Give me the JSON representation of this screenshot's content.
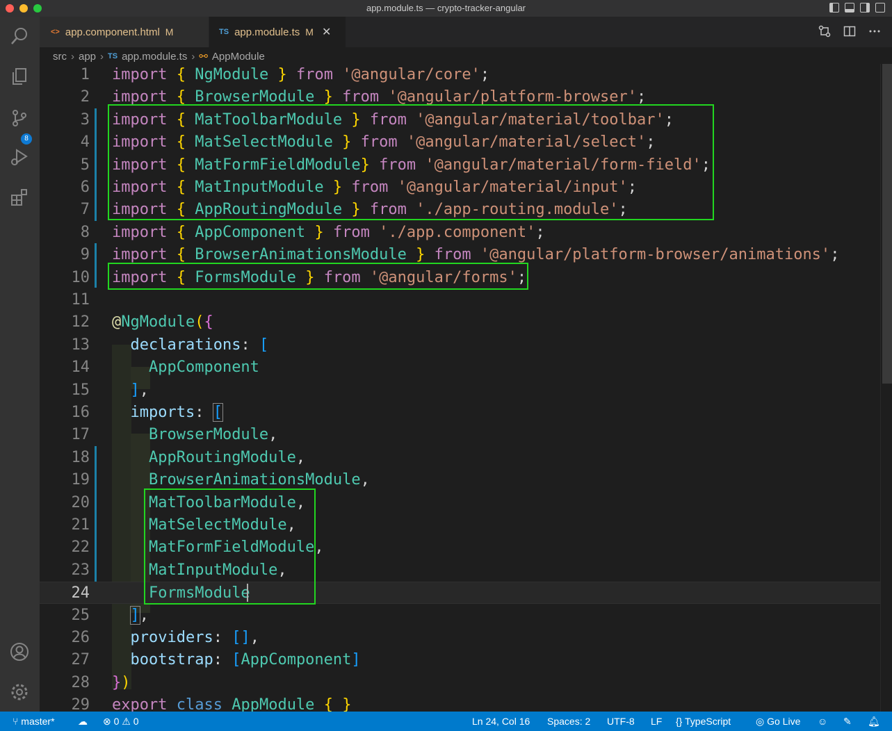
{
  "window": {
    "title": "app.module.ts — crypto-tracker-angular"
  },
  "activity_bar": {
    "scm_badge": "8"
  },
  "tabs": [
    {
      "icon": "<>",
      "label": "app.component.html",
      "status": "M"
    },
    {
      "icon": "TS",
      "label": "app.module.ts",
      "status": "M",
      "close": "✕"
    }
  ],
  "breadcrumb": {
    "parts": [
      "src",
      "app",
      "app.module.ts",
      "AppModule"
    ],
    "ts_icon": "TS",
    "sep": "›"
  },
  "code": {
    "line_numbers": [
      "1",
      "2",
      "3",
      "4",
      "5",
      "6",
      "7",
      "8",
      "9",
      "10",
      "11",
      "12",
      "13",
      "14",
      "15",
      "16",
      "17",
      "18",
      "19",
      "20",
      "21",
      "22",
      "23",
      "24",
      "25",
      "26",
      "27",
      "28",
      "29"
    ],
    "tokens": {
      "import": "import",
      "from": "from",
      "export": "export",
      "class": "class",
      "ob": "{",
      "cb": "}",
      "semi": ";",
      "ngmodule": "NgModule",
      "browsermodule": "BrowserModule",
      "toolbar": "MatToolbarModule",
      "select": "MatSelectModule",
      "formfield": "MatFormFieldModule",
      "input": "MatInputModule",
      "routing": "AppRoutingModule",
      "appcomponent": "AppComponent",
      "animations": "BrowserAnimationsModule",
      "forms": "FormsModule",
      "appmodule": "AppModule",
      "s_core": "'@angular/core'",
      "s_platform": "'@angular/platform-browser'",
      "s_toolbar": "'@angular/material/toolbar'",
      "s_select": "'@angular/material/select'",
      "s_formfield": "'@angular/material/form-field'",
      "s_input": "'@angular/material/input'",
      "s_routing": "'./app-routing.module'",
      "s_component": "'./app.component'",
      "s_animations": "'@angular/platform-browser/animations'",
      "s_forms": "'@angular/forms'",
      "at": "@",
      "decorator": "NgModule",
      "paren_open": "(",
      "paren_close": ")",
      "declarations": "declarations",
      "imports_key": "imports",
      "providers": "providers",
      "bootstrap": "bootstrap",
      "colon": ":",
      "comma": ",",
      "lb": "[",
      "rb": "]",
      "empty_arr": "[]"
    }
  },
  "status_bar": {
    "branch": "master*",
    "errors": "0",
    "warnings": "0",
    "position": "Ln 24, Col 16",
    "spaces": "Spaces: 2",
    "encoding": "UTF-8",
    "eol": "LF",
    "language": "TypeScript",
    "golive": "Go Live"
  },
  "colors": {
    "status_bar": "#007acc",
    "highlight_box": "#22d620",
    "tab_modified": "#e2c08d"
  }
}
